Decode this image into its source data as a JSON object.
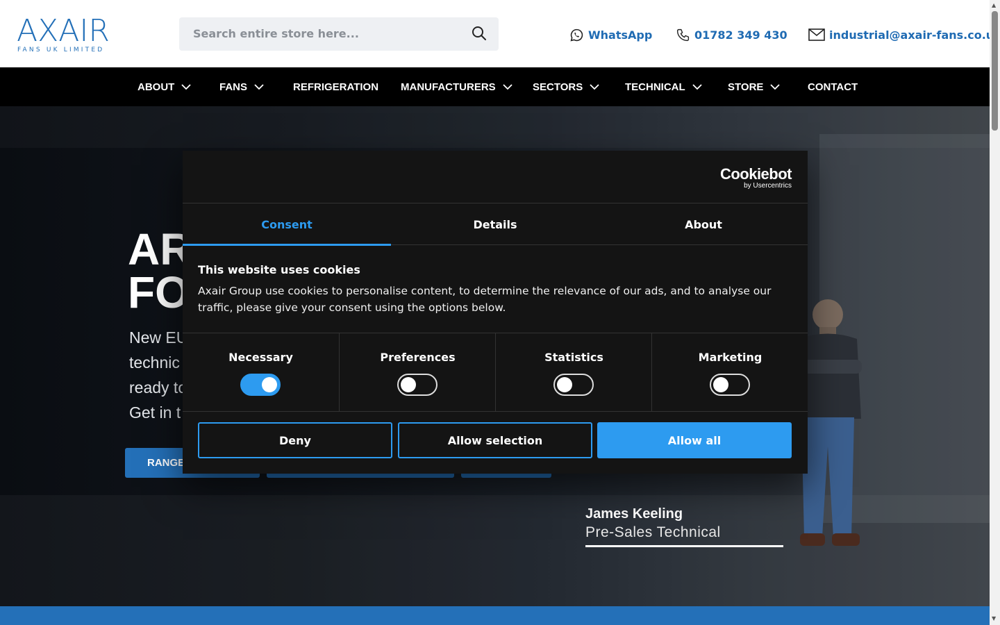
{
  "logo": {
    "main": "AXAIR",
    "sub": "FANS UK LIMITED"
  },
  "search": {
    "placeholder": "Search entire store here..."
  },
  "contact": {
    "whatsapp": "WhatsApp",
    "phone": "01782 349 430",
    "email": "industrial@axair-fans.co.uk"
  },
  "nav": {
    "items": [
      {
        "label": "ABOUT",
        "dropdown": true
      },
      {
        "label": "FANS",
        "dropdown": true
      },
      {
        "label": "REFRIGERATION",
        "dropdown": false
      },
      {
        "label": "MANUFACTURERS",
        "dropdown": true
      },
      {
        "label": "SECTORS",
        "dropdown": true
      },
      {
        "label": "TECHNICAL",
        "dropdown": true
      },
      {
        "label": "STORE",
        "dropdown": true
      },
      {
        "label": "CONTACT",
        "dropdown": false
      }
    ]
  },
  "hero": {
    "headline_line1": "AR",
    "headline_line2": "FO",
    "text_line1": "New EU",
    "text_line2": "technic",
    "text_line3": "ready to",
    "text_line4": "Get in t",
    "button1": "RANGE",
    "staff_name": "James Keeling",
    "staff_role": "Pre-Sales Technical"
  },
  "cookie": {
    "brand": "Cookiebot",
    "brand_sub": "by Usercentrics",
    "tabs": [
      "Consent",
      "Details",
      "About"
    ],
    "active_tab": "Consent",
    "title": "This website uses cookies",
    "body": "Axair Group use cookies to personalise content, to determine the relevance of our ads, and to analyse our traffic, please give your consent using the options below.",
    "toggles": [
      {
        "label": "Necessary",
        "on": true
      },
      {
        "label": "Preferences",
        "on": false
      },
      {
        "label": "Statistics",
        "on": false
      },
      {
        "label": "Marketing",
        "on": false
      }
    ],
    "buttons": {
      "deny": "Deny",
      "selection": "Allow selection",
      "all": "Allow all"
    }
  },
  "colors": {
    "brand_blue": "#2470b8",
    "cookie_accent": "#2d9bf0",
    "nav_bg": "#000000",
    "dialog_bg": "#141414"
  }
}
